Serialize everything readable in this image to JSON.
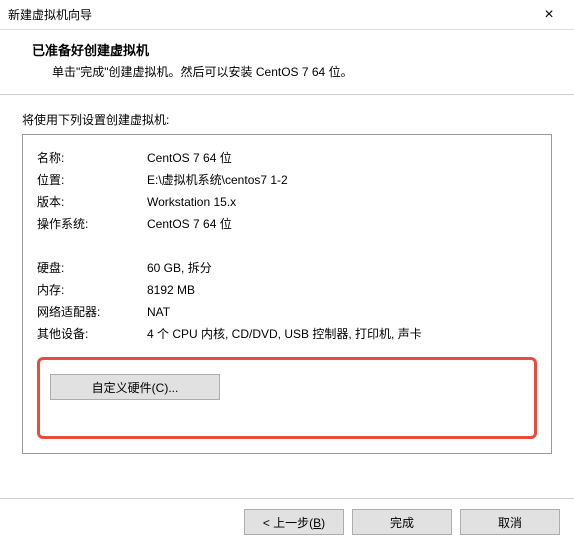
{
  "window": {
    "title": "新建虚拟机向导",
    "close": "×"
  },
  "header": {
    "title": "已准备好创建虚拟机",
    "subtitle": "单击\"完成\"创建虚拟机。然后可以安装 CentOS 7 64 位。"
  },
  "body": {
    "label": "将使用下列设置创建虚拟机:"
  },
  "settings": {
    "name_label": "名称:",
    "name_value": "CentOS 7 64 位",
    "location_label": "位置:",
    "location_value": "E:\\虚拟机系统\\centos7 1-2",
    "version_label": "版本:",
    "version_value": "Workstation 15.x",
    "os_label": "操作系统:",
    "os_value": "CentOS 7 64 位",
    "disk_label": "硬盘:",
    "disk_value": "60 GB, 拆分",
    "memory_label": "内存:",
    "memory_value": "8192 MB",
    "network_label": "网络适配器:",
    "network_value": "NAT",
    "other_label": "其他设备:",
    "other_value": "4 个 CPU 内核, CD/DVD, USB 控制器, 打印机, 声卡"
  },
  "buttons": {
    "custom_hardware": "自定义硬件(C)...",
    "back_prefix": "< 上一步(",
    "back_hotkey": "B",
    "back_suffix": ")",
    "finish": "完成",
    "cancel": "取消"
  }
}
